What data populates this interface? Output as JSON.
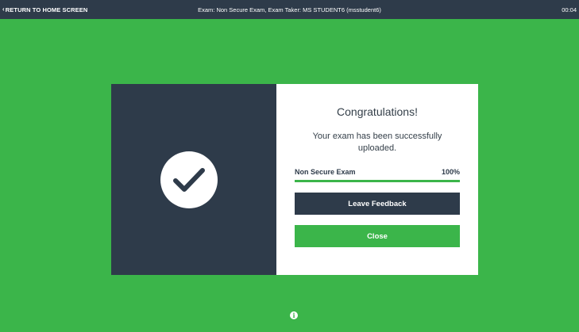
{
  "topbar": {
    "back_chevron": "‹",
    "back_label": "RETURN TO HOME SCREEN",
    "title": "Exam: Non Secure Exam, Exam Taker: MS STUDENT6 (msstudent6)",
    "timer": "00:04"
  },
  "modal": {
    "icon": "checkmark-icon",
    "heading": "Congratulations!",
    "message": "Your exam has been successfully uploaded.",
    "progress": {
      "label": "Non Secure Exam",
      "percent_text": "100%",
      "value": 100
    },
    "feedback_button": "Leave Feedback",
    "close_button": "Close"
  },
  "footer": {
    "info_icon": "info-icon",
    "info_glyph": "i"
  },
  "colors": {
    "background_green": "#3bb54a",
    "navy": "#2e3b4a",
    "white": "#ffffff"
  }
}
